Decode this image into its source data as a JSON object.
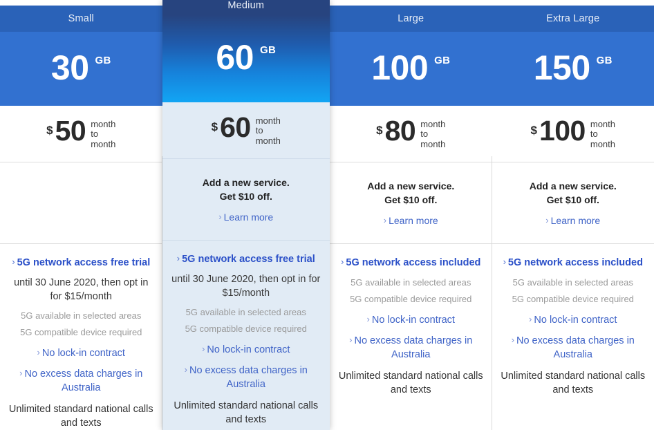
{
  "icons": {
    "chevron": "›"
  },
  "colors": {
    "header_blue": "#2a62b8",
    "data_blue": "#3271d0",
    "featured_navy": "#27447f",
    "featured_azure": "#12a5f4",
    "featured_bg": "#e1ebf5",
    "link_blue": "#3f63c7",
    "heading_blue": "#2b50c8",
    "fine_print_gray": "#9a9a9a",
    "price_text": "#2b2b2b"
  },
  "plans": [
    {
      "name": "Small",
      "featured": false,
      "data_amount": "30",
      "data_unit": "GB",
      "currency": "$",
      "price": "50",
      "term_line1": "month",
      "term_line2": "to",
      "term_line3": "month",
      "promo": {
        "has_offer": false,
        "line1": "",
        "line2": "",
        "link": ""
      },
      "fiveg_title": "5G network access free trial",
      "fiveg_sub": "until 30 June 2020, then opt in for $15/month",
      "fine1": "5G available in selected areas",
      "fine2": "5G compatible device required",
      "link1": "No lock-in contract",
      "link2": "No excess data charges in Australia",
      "plain": "Unlimited standard national calls and texts"
    },
    {
      "name": "Medium",
      "featured": true,
      "data_amount": "60",
      "data_unit": "GB",
      "currency": "$",
      "price": "60",
      "term_line1": "month",
      "term_line2": "to",
      "term_line3": "month",
      "promo": {
        "has_offer": true,
        "line1": "Add a new service.",
        "line2": "Get $10 off.",
        "link": "Learn more"
      },
      "fiveg_title": "5G network access free trial",
      "fiveg_sub": "until 30 June 2020, then opt in for $15/month",
      "fine1": "5G available in selected areas",
      "fine2": "5G compatible device required",
      "link1": "No lock-in contract",
      "link2": "No excess data charges in Australia",
      "plain": "Unlimited standard national calls and texts"
    },
    {
      "name": "Large",
      "featured": false,
      "data_amount": "100",
      "data_unit": "GB",
      "currency": "$",
      "price": "80",
      "term_line1": "month",
      "term_line2": "to",
      "term_line3": "month",
      "promo": {
        "has_offer": true,
        "line1": "Add a new service.",
        "line2": "Get $10 off.",
        "link": "Learn more"
      },
      "fiveg_title": "5G network access included",
      "fiveg_sub": "",
      "fine1": "5G available in selected areas",
      "fine2": "5G compatible device required",
      "link1": "No lock-in contract",
      "link2": "No excess data charges in Australia",
      "plain": "Unlimited standard national calls and texts"
    },
    {
      "name": "Extra Large",
      "featured": false,
      "data_amount": "150",
      "data_unit": "GB",
      "currency": "$",
      "price": "100",
      "term_line1": "month",
      "term_line2": "to",
      "term_line3": "month",
      "promo": {
        "has_offer": true,
        "line1": "Add a new service.",
        "line2": "Get $10 off.",
        "link": "Learn more"
      },
      "fiveg_title": "5G network access included",
      "fiveg_sub": "",
      "fine1": "5G available in selected areas",
      "fine2": "5G compatible device required",
      "link1": "No lock-in contract",
      "link2": "No excess data charges in Australia",
      "plain": "Unlimited standard national calls and texts"
    }
  ]
}
